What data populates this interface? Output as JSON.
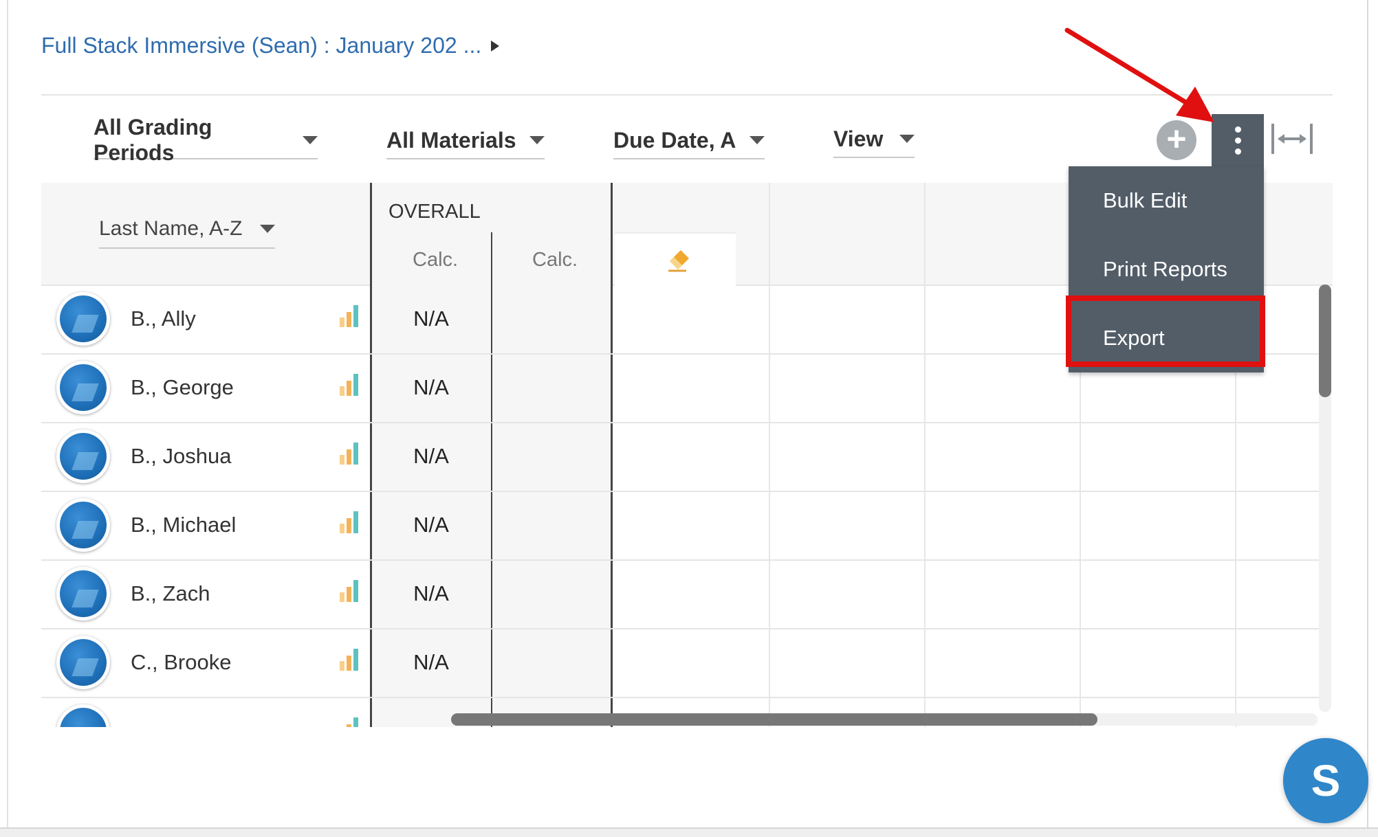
{
  "breadcrumb": {
    "text": "Full Stack Immersive (Sean) : January 202 ..."
  },
  "filters": {
    "grading_periods": "All Grading Periods",
    "materials": "All Materials",
    "sort": "Due Date, A",
    "view": "View"
  },
  "toolbar": {
    "add_symbol": "+"
  },
  "grid": {
    "student_sort": "Last Name, A-Z",
    "overall_label": "OVERALL",
    "calc_label_1": "Calc.",
    "calc_label_2": "Calc.",
    "students": [
      {
        "name": "B., Ally",
        "overall": "N/A"
      },
      {
        "name": "B., George",
        "overall": "N/A"
      },
      {
        "name": "B., Joshua",
        "overall": "N/A"
      },
      {
        "name": "B., Michael",
        "overall": "N/A"
      },
      {
        "name": "B., Zach",
        "overall": "N/A"
      },
      {
        "name": "C., Brooke",
        "overall": "N/A"
      }
    ]
  },
  "menu": {
    "items": [
      "Bulk Edit",
      "Print Reports",
      "Export"
    ],
    "highlighted_item": "Export"
  },
  "chat": {
    "initial": "S"
  },
  "colors": {
    "link": "#2f6cae",
    "menu_bg": "#525d68",
    "highlight_red": "#e01010",
    "bar_orange": "#f3b25a",
    "bar_teal": "#5cc2c0",
    "chat_blue": "#2f86c9"
  }
}
